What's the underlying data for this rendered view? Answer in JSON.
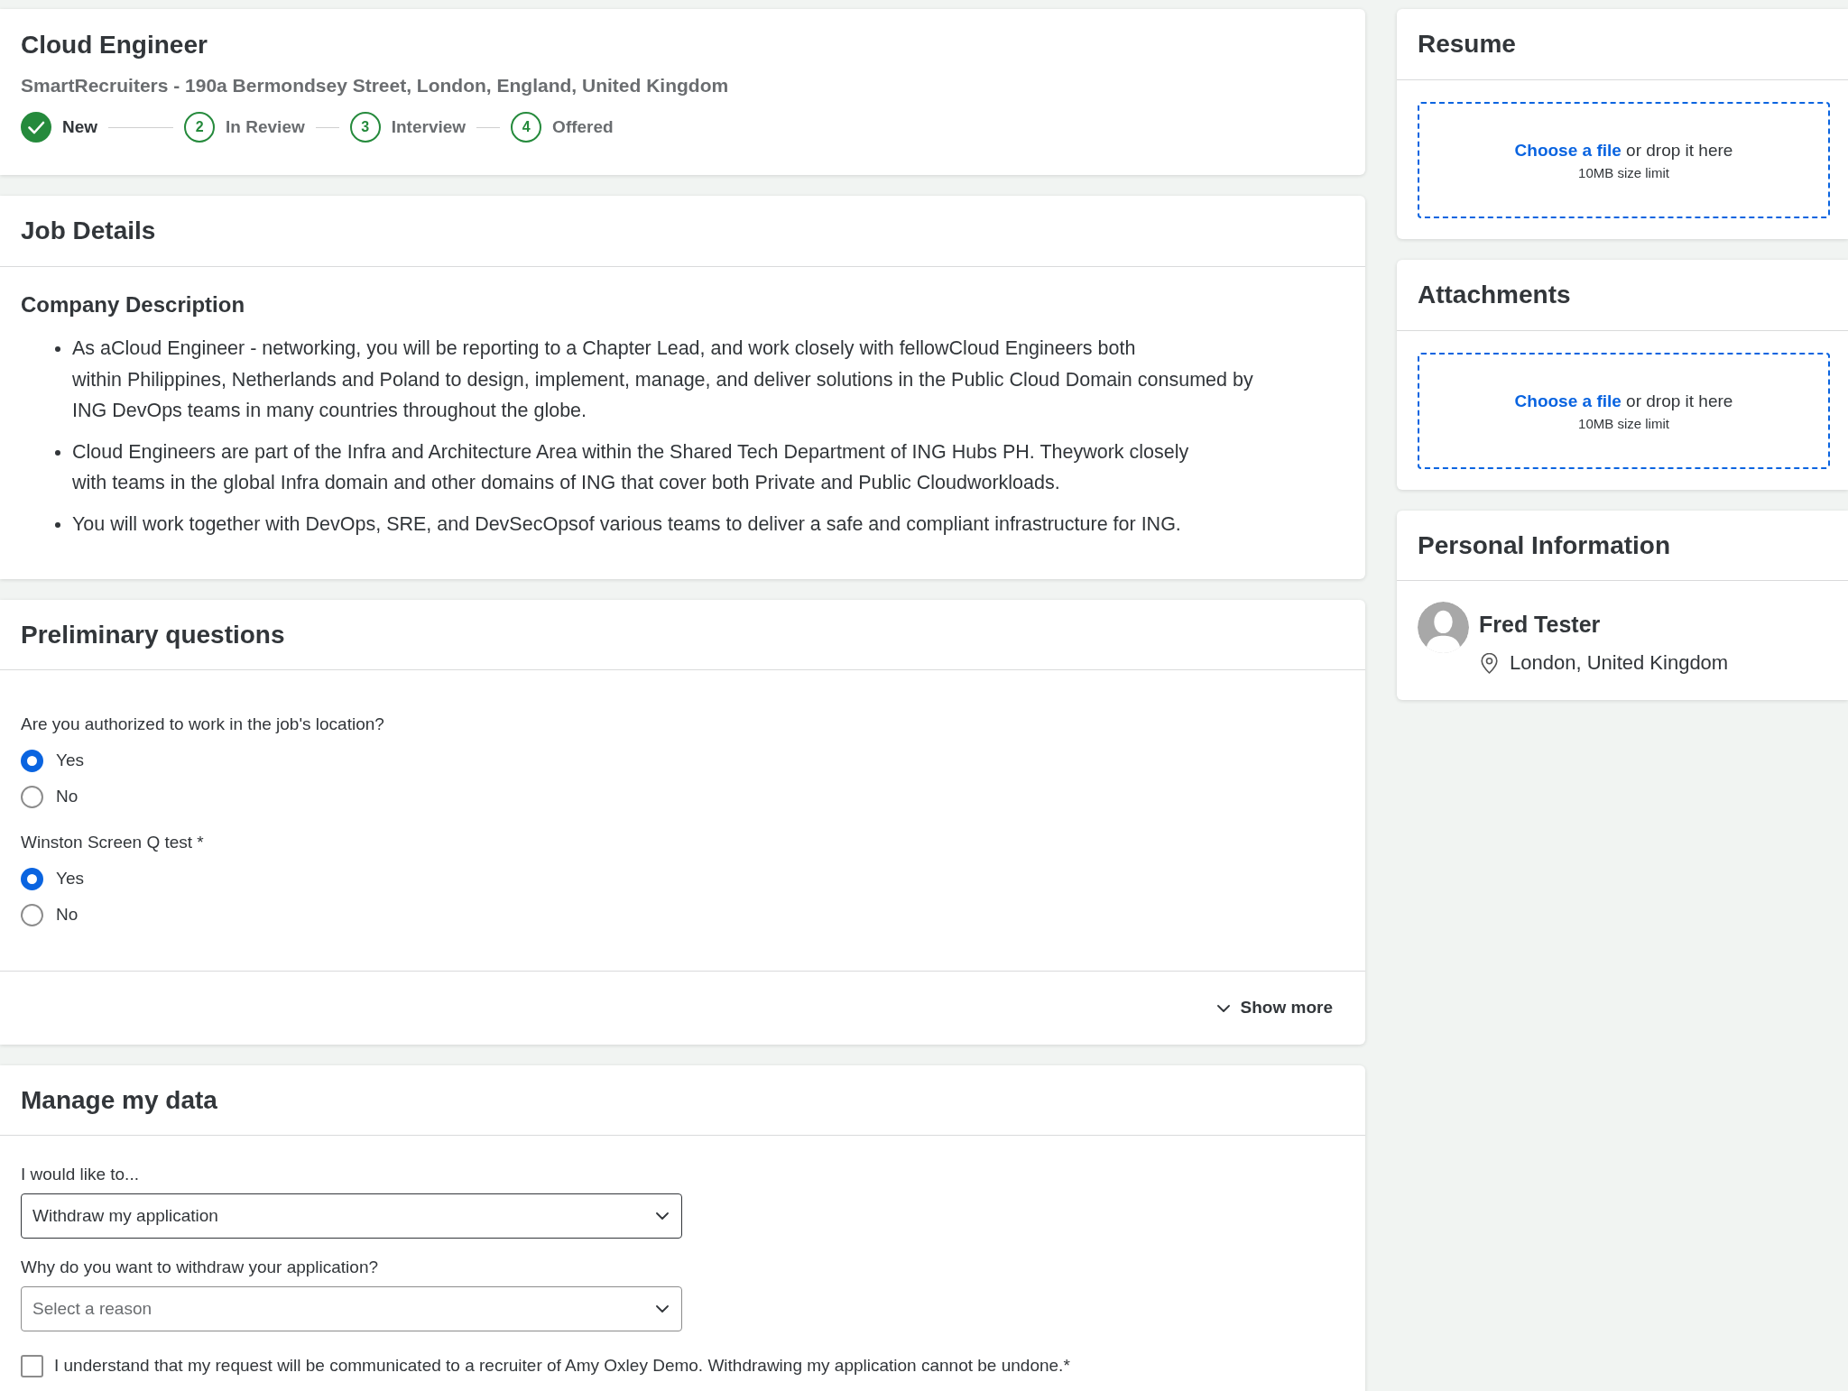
{
  "job_header": {
    "title": "Cloud Engineer",
    "subtitle": "SmartRecruiters - 190a Bermondsey Street, London, England, United Kingdom",
    "steps": [
      {
        "label": "New",
        "completed": true
      },
      {
        "number": "2",
        "label": "In Review",
        "completed": false
      },
      {
        "number": "3",
        "label": "Interview",
        "completed": false
      },
      {
        "number": "4",
        "label": "Offered",
        "completed": false
      }
    ]
  },
  "job_details": {
    "title": "Job Details",
    "section_title": "Company Description",
    "bullets": [
      "As aCloud Engineer - networking, you will be reporting to a Chapter Lead, and work closely with fellowCloud Engineers both\nwithin Philippines, Netherlands and Poland to design, implement, manage, and deliver solutions in the Public Cloud Domain consumed by ING DevOps teams in many countries throughout the globe.",
      "Cloud Engineers are part of the Infra and Architecture Area within the Shared Tech Department of ING Hubs PH. Theywork closely\nwith teams in the global Infra domain and other domains of ING that cover both Private and Public Cloudworkloads.",
      "You will work together with DevOps, SRE, and DevSecOpsof various teams to deliver a safe and compliant infrastructure for ING."
    ]
  },
  "preliminary_questions": {
    "title": "Preliminary questions",
    "questions": [
      {
        "label": "Are you authorized to work in the job's location?",
        "options": [
          {
            "label": "Yes",
            "selected": true
          },
          {
            "label": "No",
            "selected": false
          }
        ]
      },
      {
        "label": "Winston Screen Q test *",
        "options": [
          {
            "label": "Yes",
            "selected": true
          },
          {
            "label": "No",
            "selected": false
          }
        ]
      }
    ],
    "show_more": "Show more"
  },
  "manage_my_data": {
    "title": "Manage my data",
    "fields": [
      {
        "label": "I would like to...",
        "value": "Withdraw my application"
      },
      {
        "label": "Why do you want to withdraw your application?",
        "placeholder": "Select a reason"
      }
    ],
    "consent": {
      "label": "I understand that my request will be communicated to a recruiter of Amy Oxley Demo. Withdrawing my application cannot be undone.*",
      "checked": false
    }
  },
  "resume": {
    "title": "Resume",
    "dropzone": {
      "link": "Choose a file",
      "text": "or drop it here",
      "limit": "10MB size limit"
    }
  },
  "attachments": {
    "title": "Attachments",
    "dropzone": {
      "link": "Choose a file",
      "text": "or drop it here",
      "limit": "10MB size limit"
    }
  },
  "personal_information": {
    "title": "Personal Information",
    "name": "Fred Tester",
    "location": "London, United Kingdom"
  }
}
